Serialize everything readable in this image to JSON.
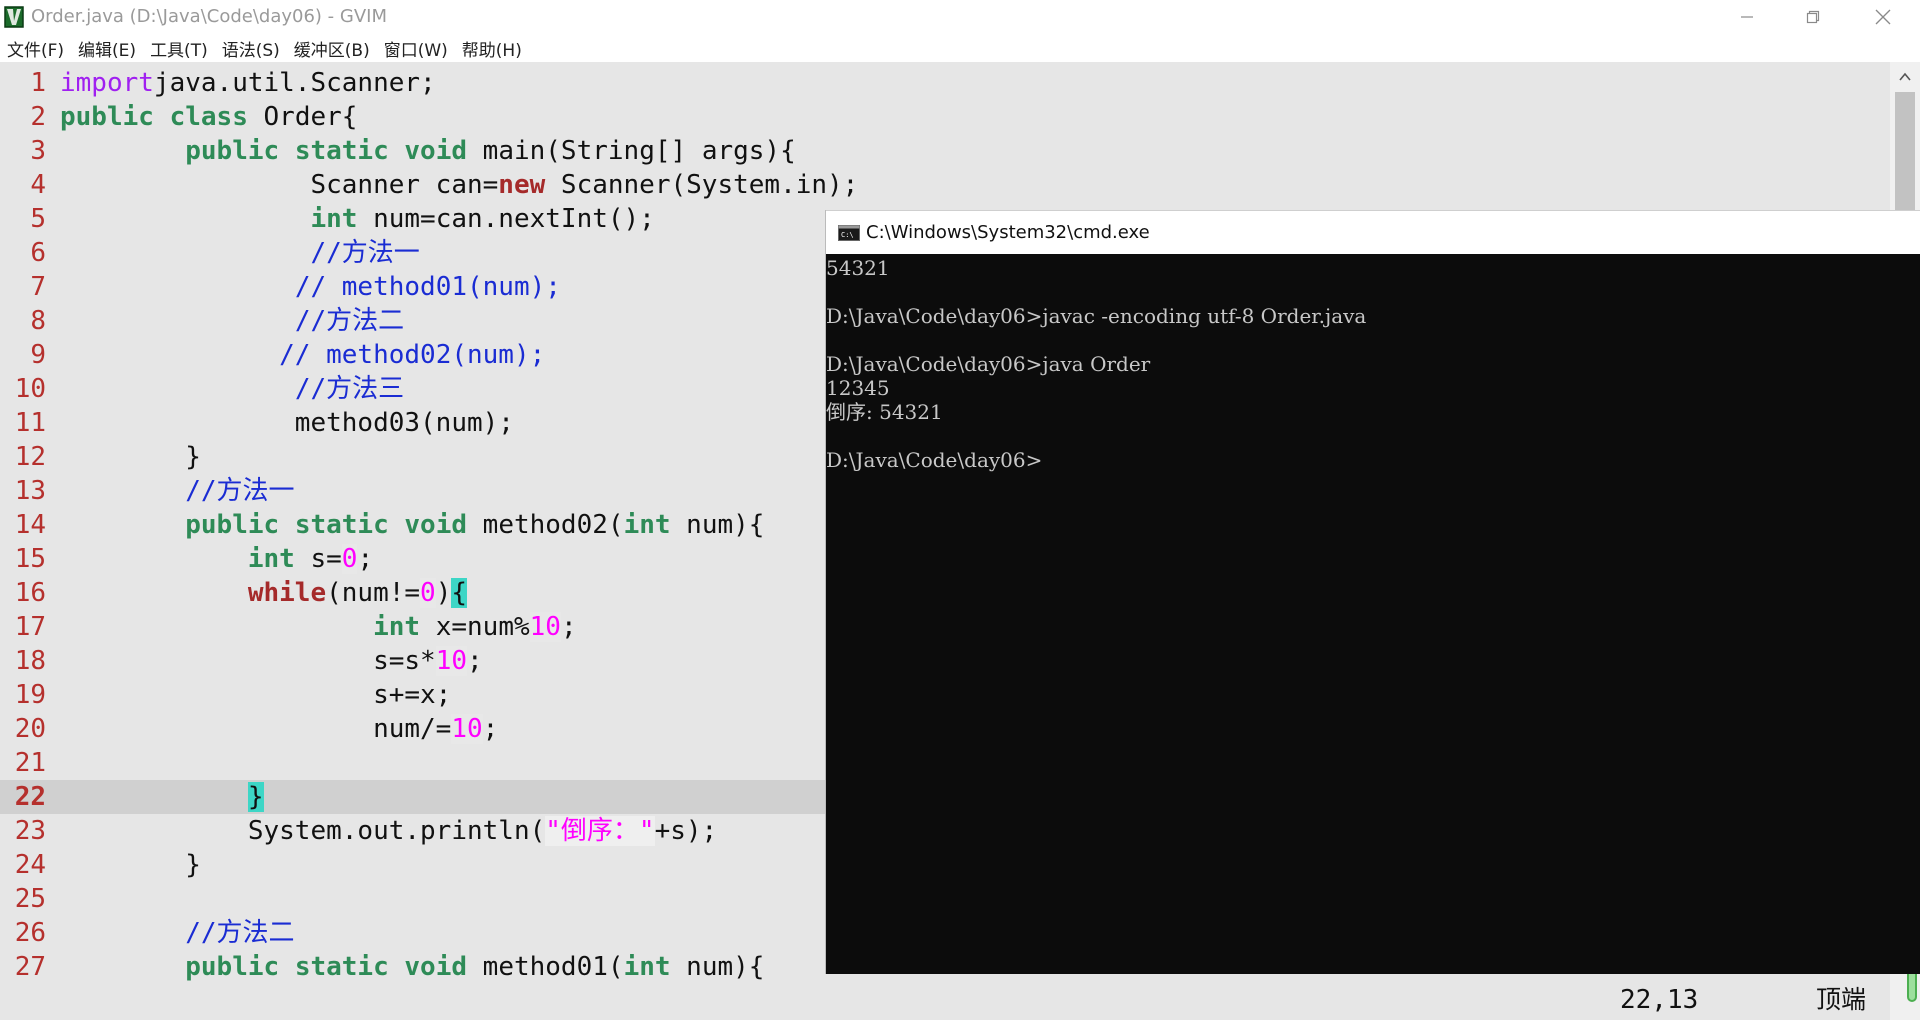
{
  "window": {
    "title": "Order.java (D:\\Java\\Code\\day06) - GVIM"
  },
  "menu": [
    "文件(F)",
    "编辑(E)",
    "工具(T)",
    "语法(S)",
    "缓冲区(B)",
    "窗口(W)",
    "帮助(H)"
  ],
  "editor": {
    "line_numbers": [
      "1",
      "2",
      "3",
      "4",
      "5",
      "6",
      "7",
      "8",
      "9",
      "10",
      "11",
      "12",
      "13",
      "14",
      "15",
      "16",
      "17",
      "18",
      "19",
      "20",
      "21",
      "22",
      "23",
      "24",
      "25",
      "26",
      "27"
    ],
    "lines": [
      [
        [
          "imp",
          "import"
        ],
        [
          "",
          "java.util.Scanner;"
        ]
      ],
      [
        [
          "kw",
          "public"
        ],
        [
          "",
          " "
        ],
        [
          "kw",
          "class"
        ],
        [
          "",
          " Order{"
        ]
      ],
      [
        [
          "",
          "        "
        ],
        [
          "kw",
          "public"
        ],
        [
          "",
          " "
        ],
        [
          "kw",
          "static"
        ],
        [
          "",
          " "
        ],
        [
          "kw",
          "void"
        ],
        [
          "",
          " main(String[] args){"
        ]
      ],
      [
        [
          "",
          "                Scanner can="
        ],
        [
          "new",
          "new"
        ],
        [
          "",
          " Scanner(System.in);"
        ]
      ],
      [
        [
          "",
          "                "
        ],
        [
          "kw",
          "int"
        ],
        [
          "",
          " num=can.nextInt();"
        ]
      ],
      [
        [
          "",
          "                "
        ],
        [
          "cmt",
          "//方法一"
        ]
      ],
      [
        [
          "",
          "               "
        ],
        [
          "cmt",
          "// method01(num);"
        ]
      ],
      [
        [
          "",
          "               "
        ],
        [
          "cmt",
          "//方法二"
        ]
      ],
      [
        [
          "",
          "              "
        ],
        [
          "cmt",
          "// method02(num);"
        ]
      ],
      [
        [
          "",
          "               "
        ],
        [
          "cmt",
          "//方法三"
        ]
      ],
      [
        [
          "",
          "               method03(num);"
        ]
      ],
      [
        [
          "",
          "        }"
        ]
      ],
      [
        [
          "",
          "        "
        ],
        [
          "cmt",
          "//方法一"
        ]
      ],
      [
        [
          "",
          "        "
        ],
        [
          "kw",
          "public"
        ],
        [
          "",
          " "
        ],
        [
          "kw",
          "static"
        ],
        [
          "",
          " "
        ],
        [
          "kw",
          "void"
        ],
        [
          "",
          " method02("
        ],
        [
          "kw",
          "int"
        ],
        [
          "",
          " num){"
        ]
      ],
      [
        [
          "",
          "            "
        ],
        [
          "kw",
          "int"
        ],
        [
          "",
          " s="
        ],
        [
          "num",
          "0"
        ],
        [
          "",
          ";"
        ]
      ],
      [
        [
          "",
          "            "
        ],
        [
          "new",
          "while"
        ],
        [
          "",
          "(num!="
        ],
        [
          "num",
          "0"
        ],
        [
          "",
          ")"
        ],
        [
          "brace",
          "{"
        ]
      ],
      [
        [
          "",
          "                    "
        ],
        [
          "kw",
          "int"
        ],
        [
          "",
          " x=num%"
        ],
        [
          "num",
          "10"
        ],
        [
          "",
          ";"
        ]
      ],
      [
        [
          "",
          "                    s=s*"
        ],
        [
          "num",
          "10"
        ],
        [
          "",
          ";"
        ]
      ],
      [
        [
          "",
          "                    s+=x;"
        ]
      ],
      [
        [
          "",
          "                    num/="
        ],
        [
          "num",
          "10"
        ],
        [
          "",
          ";"
        ]
      ],
      [
        [
          "",
          ""
        ]
      ],
      [
        [
          "",
          "            "
        ],
        [
          "brace",
          "}"
        ]
      ],
      [
        [
          "",
          "            System.out.println("
        ],
        [
          "str",
          "\"倒序：\""
        ],
        [
          "",
          "+s);"
        ]
      ],
      [
        [
          "",
          "        }"
        ]
      ],
      [
        [
          "",
          ""
        ]
      ],
      [
        [
          "",
          "        "
        ],
        [
          "cmt",
          "//方法二"
        ]
      ],
      [
        [
          "",
          "        "
        ],
        [
          "kw",
          "public"
        ],
        [
          "",
          " "
        ],
        [
          "kw",
          "static"
        ],
        [
          "",
          " "
        ],
        [
          "kw",
          "void"
        ],
        [
          "",
          " method01("
        ],
        [
          "kw",
          "int"
        ],
        [
          "",
          " num){"
        ]
      ]
    ],
    "current_line": "22"
  },
  "status": {
    "cursor": "22,13",
    "position": "顶端"
  },
  "cmd": {
    "title": "C:\\Windows\\System32\\cmd.exe",
    "lines": [
      "54321",
      "",
      "D:\\Java\\Code\\day06>javac -encoding utf-8 Order.java",
      "",
      "D:\\Java\\Code\\day06>java Order",
      "12345",
      "倒序: 54321",
      "",
      "D:\\Java\\Code\\day06>"
    ]
  },
  "colors": {
    "keyword": "#2e8b57",
    "comment": "#1a2cd3",
    "number": "#ff00ff",
    "line_number": "#b5302d",
    "editor_bg": "#e6e6e6",
    "cmd_bg": "#0c0c0c"
  },
  "icons": {
    "app": "gvim-icon",
    "minimize": "minimize-icon",
    "maximize": "restore-icon",
    "close": "close-icon",
    "cmd": "cmd-icon",
    "scroll_up": "chevron-up-icon"
  }
}
